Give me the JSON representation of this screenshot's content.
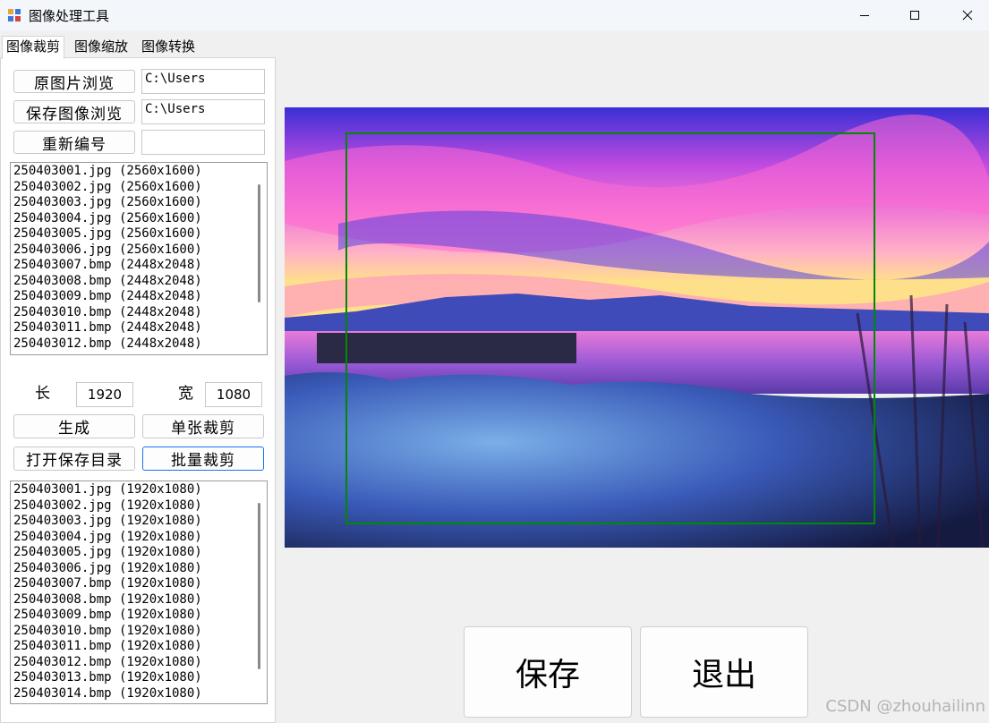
{
  "window": {
    "title": "图像处理工具",
    "minimize_icon": "minimize-icon",
    "maximize_icon": "maximize-icon",
    "close_icon": "close-icon"
  },
  "tabs": [
    {
      "label": "图像裁剪",
      "active": true
    },
    {
      "label": "图像缩放",
      "active": false
    },
    {
      "label": "图像转换",
      "active": false
    }
  ],
  "crop_panel": {
    "browse_source_label": "原图片浏览",
    "source_path": "C:\\Users",
    "browse_save_label": "保存图像浏览",
    "save_path": "C:\\Users",
    "renumber_label": "重新编号",
    "renumber_value": "",
    "source_files": [
      "250403001.jpg (2560x1600)",
      "250403002.jpg (2560x1600)",
      "250403003.jpg (2560x1600)",
      "250403004.jpg (2560x1600)",
      "250403005.jpg (2560x1600)",
      "250403006.jpg (2560x1600)",
      "250403007.bmp (2448x2048)",
      "250403008.bmp (2448x2048)",
      "250403009.bmp (2448x2048)",
      "250403010.bmp (2448x2048)",
      "250403011.bmp (2448x2048)",
      "250403012.bmp (2448x2048)"
    ],
    "length_label": "长",
    "length_value": "1920",
    "width_label": "宽",
    "width_value": "1080",
    "generate_label": "生成",
    "single_crop_label": "单张裁剪",
    "open_save_dir_label": "打开保存目录",
    "batch_crop_label": "批量裁剪",
    "output_files": [
      "250403001.jpg (1920x1080)",
      "250403002.jpg (1920x1080)",
      "250403003.jpg (1920x1080)",
      "250403004.jpg (1920x1080)",
      "250403005.jpg (1920x1080)",
      "250403006.jpg (1920x1080)",
      "250403007.bmp (1920x1080)",
      "250403008.bmp (1920x1080)",
      "250403009.bmp (1920x1080)",
      "250403010.bmp (1920x1080)",
      "250403011.bmp (1920x1080)",
      "250403012.bmp (1920x1080)",
      "250403013.bmp (1920x1080)",
      "250403014.bmp (1920x1080)"
    ]
  },
  "actions": {
    "save_label": "保存",
    "exit_label": "退出"
  },
  "watermark": "CSDN @zhouhailinn",
  "colors": {
    "crop_rect": "#008a00",
    "focus_border": "#1a73e8"
  }
}
